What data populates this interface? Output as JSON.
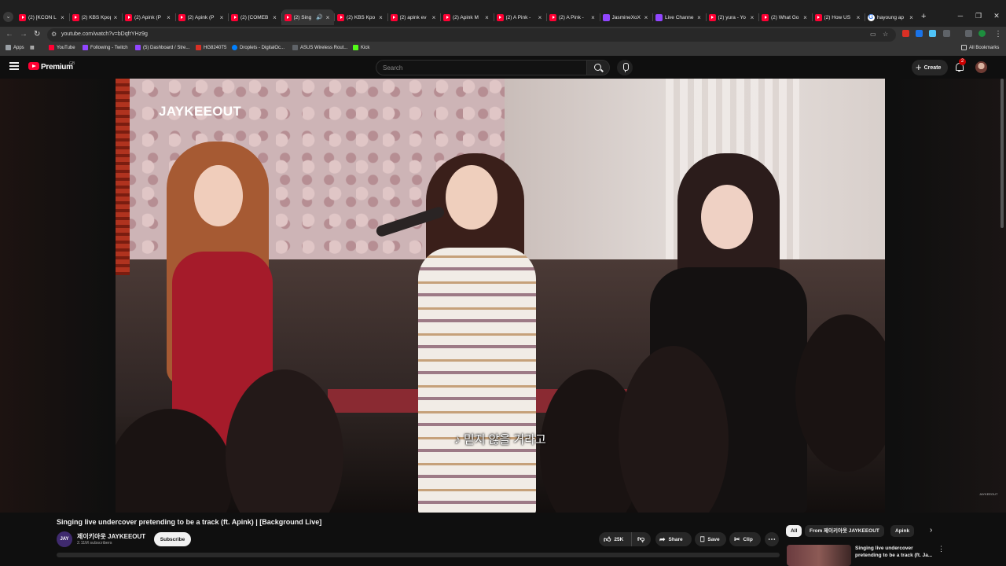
{
  "browser": {
    "tabs": [
      {
        "title": "(2) [KCON L",
        "favicon": "youtube"
      },
      {
        "title": "(2) KBS Kpop",
        "favicon": "youtube"
      },
      {
        "title": "(2) Apink (P",
        "favicon": "youtube"
      },
      {
        "title": "(2) Apink (P",
        "favicon": "youtube"
      },
      {
        "title": "(2) [COMEB",
        "favicon": "youtube"
      },
      {
        "title": "(2) Sing",
        "favicon": "youtube",
        "active": true,
        "audio": "🔊"
      },
      {
        "title": "(2) KBS Kpo",
        "favicon": "youtube"
      },
      {
        "title": "(2) apink ev",
        "favicon": "youtube"
      },
      {
        "title": "(2) Apink M",
        "favicon": "youtube"
      },
      {
        "title": "(2) A Pink -",
        "favicon": "youtube"
      },
      {
        "title": "(2) A Pink -",
        "favicon": "youtube"
      },
      {
        "title": "JasmineXoX",
        "favicon": "twitch"
      },
      {
        "title": "Live Channe",
        "favicon": "twitch"
      },
      {
        "title": "(2) yura - Yo",
        "favicon": "youtube"
      },
      {
        "title": "(2) What Go",
        "favicon": "youtube"
      },
      {
        "title": "(2) How US",
        "favicon": "youtube"
      },
      {
        "title": "hayoung ap",
        "favicon": "google"
      }
    ],
    "url": "youtube.com/watch?v=bDqfrYHz9g",
    "bookmarks": [
      {
        "label": "Apps",
        "icon": "apps-grid-icon",
        "color": "#9aa0a6"
      },
      {
        "label": "YouTube",
        "icon": "youtube-icon",
        "color": "#ff0033"
      },
      {
        "label": "Following - Twitch",
        "icon": "twitch-icon",
        "color": "#9146ff"
      },
      {
        "label": "(5) Dashboard / Stre...",
        "icon": "twitch-icon",
        "color": "#9146ff"
      },
      {
        "label": "HG8240T5",
        "icon": "router-icon",
        "color": "#d93025"
      },
      {
        "label": "Droplets - DigitalOc...",
        "icon": "digitalocean-icon",
        "color": "#0080ff"
      },
      {
        "label": "ASUS Wireless Rout...",
        "icon": "asus-icon",
        "color": "#5f6368"
      },
      {
        "label": "Kick",
        "icon": "kick-icon",
        "color": "#53fc18"
      }
    ],
    "all_bookmarks": "All Bookmarks"
  },
  "masthead": {
    "logo_text": "Premium",
    "region_code": "GB",
    "search_placeholder": "Search",
    "create_label": "Create",
    "notification_count": "2"
  },
  "player": {
    "watermark": "JAYKEEOUT",
    "subtitle": "♪ 믿지 않을 거라고",
    "corner_mark": "JAYKEEOUT"
  },
  "video": {
    "title": "Singing live undercover pretending to be a track (ft. Apink) | [Background Live]",
    "channel_avatar_text": "JAY",
    "channel_name": "제이키아웃 JAYKEEOUT",
    "subscriber_count": "2.11M subscribers",
    "subscribe_label": "Subscribe",
    "like_count": "25K",
    "share_label": "Share",
    "save_label": "Save",
    "clip_label": "Clip"
  },
  "sidebar": {
    "chips": [
      "All",
      "From 제이키아웃 JAYKEEOUT",
      "Apink"
    ],
    "selected_chip": "All",
    "recommendation_title": "Singing live undercover pretending to be a track (ft. Ja..."
  },
  "colors": {
    "youtube_red": "#ff0033",
    "background": "#0f0f0f",
    "chip_bg": "#272727"
  }
}
